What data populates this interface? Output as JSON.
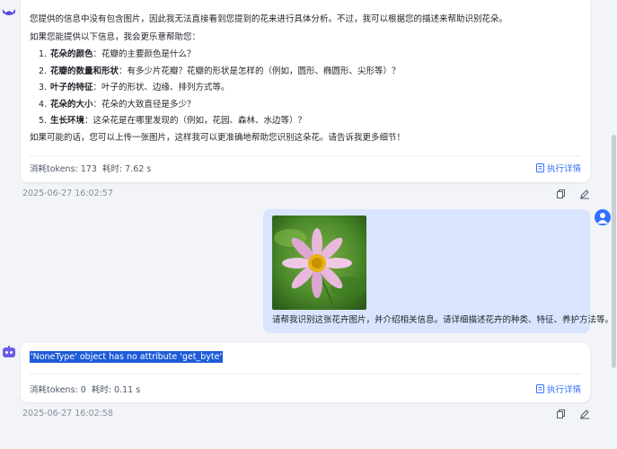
{
  "messages": {
    "ai_first": {
      "intro": "您提供的信息中没有包含图片，因此我无法直接看到您提到的花来进行具体分析。不过，我可以根据您的描述来帮助识别花朵。",
      "lead": "如果您能提供以下信息，我会更乐意帮助您：",
      "items": [
        {
          "num": "1.",
          "title": "花朵的颜色",
          "text": "：花瓣的主要颜色是什么？"
        },
        {
          "num": "2.",
          "title": "花瓣的数量和形状",
          "text": "：有多少片花瓣？花瓣的形状是怎样的（例如，圆形、椭圆形、尖形等）？"
        },
        {
          "num": "3.",
          "title": "叶子的特征",
          "text": "：叶子的形状、边缘、排列方式等。"
        },
        {
          "num": "4.",
          "title": "花朵的大小",
          "text": "：花朵的大致直径是多少？"
        },
        {
          "num": "5.",
          "title": "生长环境",
          "text": "：这朵花是在哪里发现的（例如，花园、森林、水边等）？"
        }
      ],
      "outro": "如果可能的话，您可以上传一张图片，这样我可以更准确地帮助您识别这朵花。请告诉我更多细节！",
      "tokens": "消耗tokens: 173",
      "time": "耗时: 7.62 s",
      "detail_label": "执行详情",
      "timestamp": "2025-06-27 16:02:57"
    },
    "user": {
      "text": "请帮我识别这张花卉图片，并介绍相关信息。请详细描述花卉的种类、特征、养护方法等。"
    },
    "ai_second": {
      "error": "'NoneType' object has no attribute 'get_byte'",
      "tokens": "消耗tokens: 0",
      "time": "耗时: 0.11 s",
      "detail_label": "执行详情",
      "timestamp": "2025-06-27 16:02:58"
    }
  },
  "colors": {
    "accent": "#3370ff",
    "user_bubble": "#d9e5ff",
    "page_bg": "#f2f4f8",
    "selection": "#1e5bd8"
  }
}
